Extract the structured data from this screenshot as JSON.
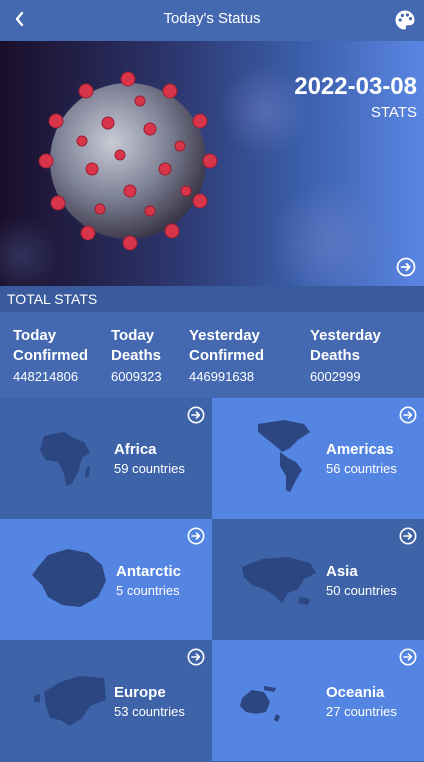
{
  "header": {
    "title": "Today's Status"
  },
  "hero": {
    "date": "2022-03-08",
    "caption": "STATS"
  },
  "totals": {
    "heading": "TOTAL STATS",
    "items": [
      {
        "label": "Today Confirmed",
        "value": "448214806"
      },
      {
        "label": "Today Deaths",
        "value": "6009323"
      },
      {
        "label": "Yesterday Confirmed",
        "value": "446991638"
      },
      {
        "label": "Yesterday Deaths",
        "value": "6002999"
      }
    ]
  },
  "regions": [
    {
      "name": "Africa",
      "count": "59 countries"
    },
    {
      "name": "Americas",
      "count": "56 countries"
    },
    {
      "name": "Antarctic",
      "count": "5 countries"
    },
    {
      "name": "Asia",
      "count": "50 countries"
    },
    {
      "name": "Europe",
      "count": "53 countries"
    },
    {
      "name": "Oceania",
      "count": "27 countries"
    }
  ],
  "colors": {
    "appbar": "#4469b1",
    "tile_dark": "#3f63a8",
    "tile_light": "#5585e2",
    "map": "#2b4680"
  },
  "icons": {
    "back": "chevron-left-icon",
    "palette": "palette-icon",
    "go": "arrow-circle-right-icon"
  }
}
